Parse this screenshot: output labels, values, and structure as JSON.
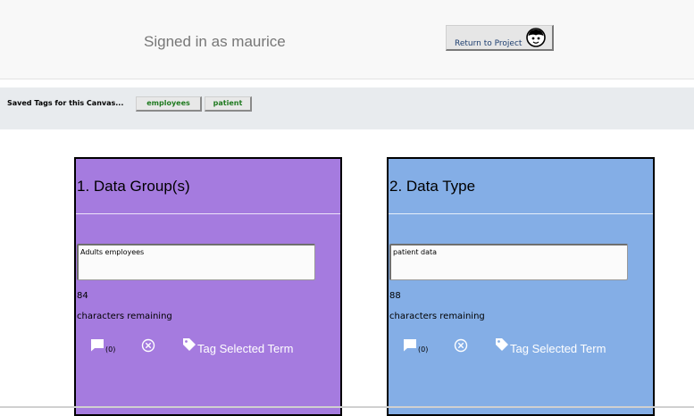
{
  "header": {
    "signed_in_text": "Signed in as maurice",
    "return_button_label": "Return to Project",
    "return_button_icon": "smiley-face-icon"
  },
  "tagbar": {
    "label": "Saved Tags for this Canvas...",
    "tags": [
      {
        "label": "employees",
        "color": "#1f7a1f"
      },
      {
        "label": "patient",
        "color": "#1f7a1f"
      }
    ]
  },
  "panels": [
    {
      "title": "1. Data Group(s)",
      "color": "#a57bdf",
      "input_value": "Adults employees",
      "characters_remaining": "84",
      "remaining_label": "characters remaining",
      "comment_count": "(0)",
      "tag_action_label": "Tag Selected Term"
    },
    {
      "title": "2. Data Type",
      "color": "#84aee6",
      "input_value": "patient data",
      "characters_remaining": "88",
      "remaining_label": "characters remaining",
      "comment_count": "(0)",
      "tag_action_label": "Tag Selected Term"
    }
  ]
}
